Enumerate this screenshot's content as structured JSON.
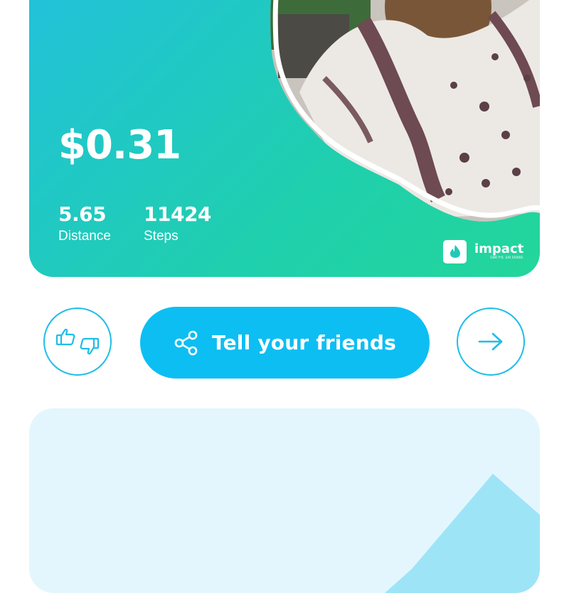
{
  "summary": {
    "amount": "$0.31",
    "distance_value": "5.65",
    "distance_label": "Distance",
    "steps_value": "11424",
    "steps_label": "Steps"
  },
  "brand": {
    "name": "impact",
    "tagline": "Get Fit. Do Good."
  },
  "actions": {
    "vote_icons": [
      "thumbs-up-icon",
      "thumbs-down-icon"
    ],
    "share_label": "Tell your friends",
    "share_icon": "share-icon",
    "next_icon": "arrow-right-icon"
  },
  "colors": {
    "accent": "#0dbef3",
    "card_gradient_start": "#22c1dc",
    "card_gradient_end": "#23d69a",
    "lower_card": "#e4f6fd"
  }
}
